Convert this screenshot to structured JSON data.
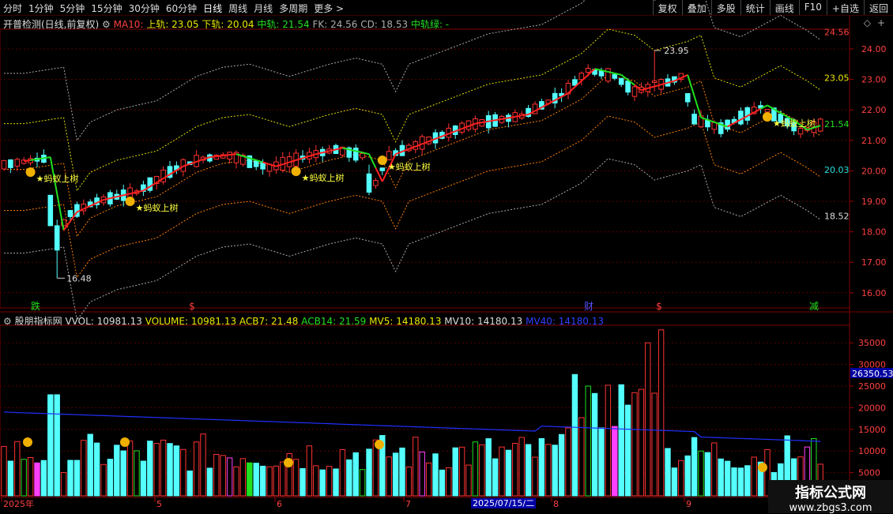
{
  "toolbar": {
    "periods": [
      "分时",
      "1分钟",
      "5分钟",
      "15分钟",
      "30分钟",
      "60分钟",
      "日线",
      "周线",
      "月线",
      "多周期",
      "更多 >"
    ],
    "active_period": "日线",
    "right_buttons": [
      "复权",
      "叠加",
      "多股",
      "统计",
      "画线",
      "F10",
      "+自选",
      "返回"
    ]
  },
  "main_panel": {
    "title": "开普检测(日线,前复权)",
    "indicator_name": "MA10:",
    "upper_label": "上轨: 23.05",
    "lower_label": "下轨: 20.04",
    "middle_label": "中轨: 21.54",
    "fk_label": "FK: 24.56",
    "cd_label": "CD: 18.53",
    "mid_green_label": "中轨绿: -",
    "y_ticks": [
      "24.00",
      "23.00",
      "22.00",
      "21.00",
      "20.00",
      "19.00",
      "18.00",
      "17.00",
      "16.00"
    ],
    "right_labels": {
      "fk": "24.56",
      "upper": "23.05",
      "middle": "21.54",
      "lower": "20.03",
      "cd": "18.52"
    },
    "high_annotation": "23.95",
    "low_annotation": "16.48",
    "signal_text": "★蚂蚁上树",
    "event_markers": [
      "跌",
      "$",
      "财",
      "$",
      "减"
    ]
  },
  "volume_panel": {
    "title": "股朋指标网",
    "vvol": "VVOL: 10981.13",
    "volume": "VOLUME: 10981.13",
    "acb7": "ACB7: 21.48",
    "acb14": "ACB14: 21.59",
    "mv5": "MV5: 14180.13",
    "mv10": "MV10: 14180.13",
    "mv40": "MV40: 14180.13",
    "y_ticks": [
      "35000",
      "30000",
      "25000",
      "20000",
      "15000",
      "10000",
      "5000"
    ],
    "current_value": "26350.53"
  },
  "x_axis": {
    "labels": [
      "2025年",
      "5",
      "6",
      "7",
      "8",
      "9"
    ],
    "cursor_date": "2025/07/15/二"
  },
  "watermark": {
    "line1": "指标公式网",
    "line2": "www.zbgs3.com"
  },
  "colors": {
    "up": "#ff3232",
    "down": "#54ffff",
    "upper_band": "#b4b4b4",
    "lower_band": "#ff8000",
    "ma_red": "#ff2020",
    "ma_green": "#20e020",
    "vol_ma": "#2030ff"
  }
}
